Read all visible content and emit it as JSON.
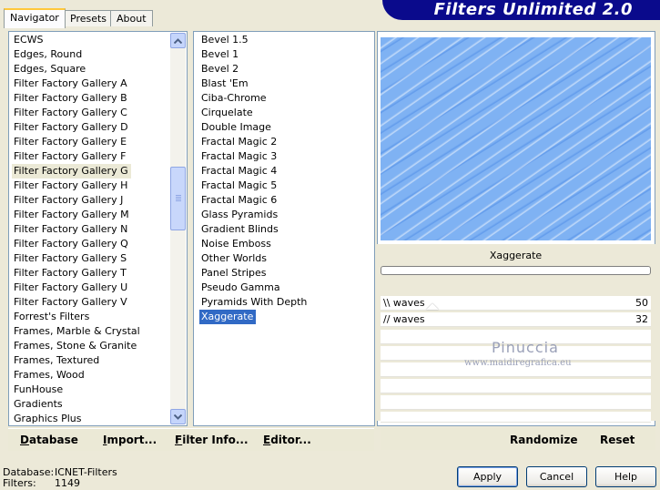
{
  "app": {
    "title": "Filters Unlimited 2.0"
  },
  "tabs": [
    {
      "label": "Navigator",
      "active": true
    },
    {
      "label": "Presets",
      "active": false
    },
    {
      "label": "About",
      "active": false
    }
  ],
  "categories": {
    "items": [
      "ECWS",
      "Edges, Round",
      "Edges, Square",
      "Filter Factory Gallery A",
      "Filter Factory Gallery B",
      "Filter Factory Gallery C",
      "Filter Factory Gallery D",
      "Filter Factory Gallery E",
      "Filter Factory Gallery F",
      "Filter Factory Gallery G",
      "Filter Factory Gallery H",
      "Filter Factory Gallery J",
      "Filter Factory Gallery M",
      "Filter Factory Gallery N",
      "Filter Factory Gallery Q",
      "Filter Factory Gallery S",
      "Filter Factory Gallery T",
      "Filter Factory Gallery U",
      "Filter Factory Gallery V",
      "Forrest's Filters",
      "Frames, Marble & Crystal",
      "Frames, Stone & Granite",
      "Frames, Textured",
      "Frames, Wood",
      "FunHouse",
      "Gradients",
      "Graphics Plus"
    ],
    "selected": "Filter Factory Gallery G"
  },
  "filters": {
    "items": [
      "Bevel 1.5",
      "Bevel 1",
      "Bevel 2",
      "Blast 'Em",
      "Ciba-Chrome",
      "Cirquelate",
      "Double Image",
      "Fractal Magic 2",
      "Fractal Magic 3",
      "Fractal Magic 4",
      "Fractal Magic 5",
      "Fractal Magic 6",
      "Glass Pyramids",
      "Gradient Blinds",
      "Noise Emboss",
      "Other Worlds",
      "Panel Stripes",
      "Pseudo Gamma",
      "Pyramids With Depth",
      "Xaggerate"
    ],
    "selected": "Xaggerate"
  },
  "preview": {
    "filter_name": "Xaggerate"
  },
  "params": [
    {
      "label": "\\\\ waves",
      "value": "50"
    },
    {
      "label": "// waves",
      "value": "32"
    }
  ],
  "watermark": {
    "name": "Pinuccia",
    "url": "www.maidiregrafica.eu"
  },
  "toolbar": {
    "database": "Database",
    "import": "Import...",
    "filter_info": "Filter Info...",
    "editor": "Editor...",
    "randomize": "Randomize",
    "reset": "Reset"
  },
  "status": {
    "database_label": "Database:",
    "database_value": "ICNET-Filters",
    "filters_label": "Filters:",
    "filters_value": "1149"
  },
  "buttons": {
    "apply": "Apply",
    "cancel": "Cancel",
    "help": "Help"
  }
}
